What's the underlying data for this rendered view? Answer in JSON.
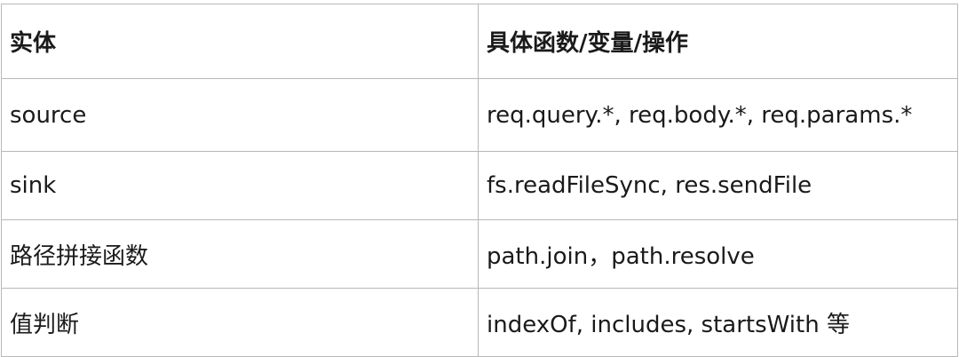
{
  "table": {
    "headers": [
      "实体",
      "具体函数/变量/操作"
    ],
    "rows": [
      [
        "source",
        "req.query.*, req.body.*, req.params.*"
      ],
      [
        "sink",
        "fs.readFileSync, res.sendFile"
      ],
      [
        "路径拼接函数",
        "path.join，path.resolve"
      ],
      [
        "值判断",
        "indexOf, includes, startsWith 等"
      ]
    ]
  }
}
